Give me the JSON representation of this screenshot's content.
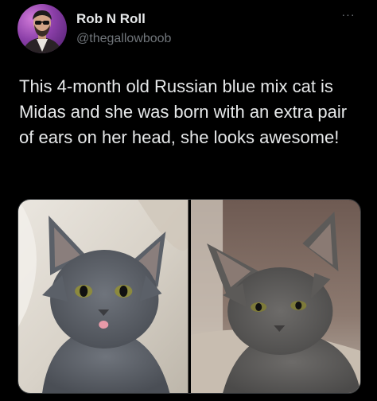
{
  "author": {
    "display_name": "Rob N Roll",
    "handle": "@thegallowboob",
    "avatar_icon": "profile-avatar"
  },
  "menu": {
    "more_label": "···",
    "more_icon": "more-dots-icon"
  },
  "tweet": {
    "text": "This 4-month old Russian blue mix cat is Midas and she was born with an extra pair of ears on her head, she looks awesome!"
  },
  "media": {
    "photos": [
      {
        "name": "cat-photo-left"
      },
      {
        "name": "cat-photo-right"
      }
    ]
  },
  "colors": {
    "background": "#000000",
    "text_primary": "#e7e9ea",
    "text_secondary": "#71767b",
    "border": "#2f3336"
  }
}
